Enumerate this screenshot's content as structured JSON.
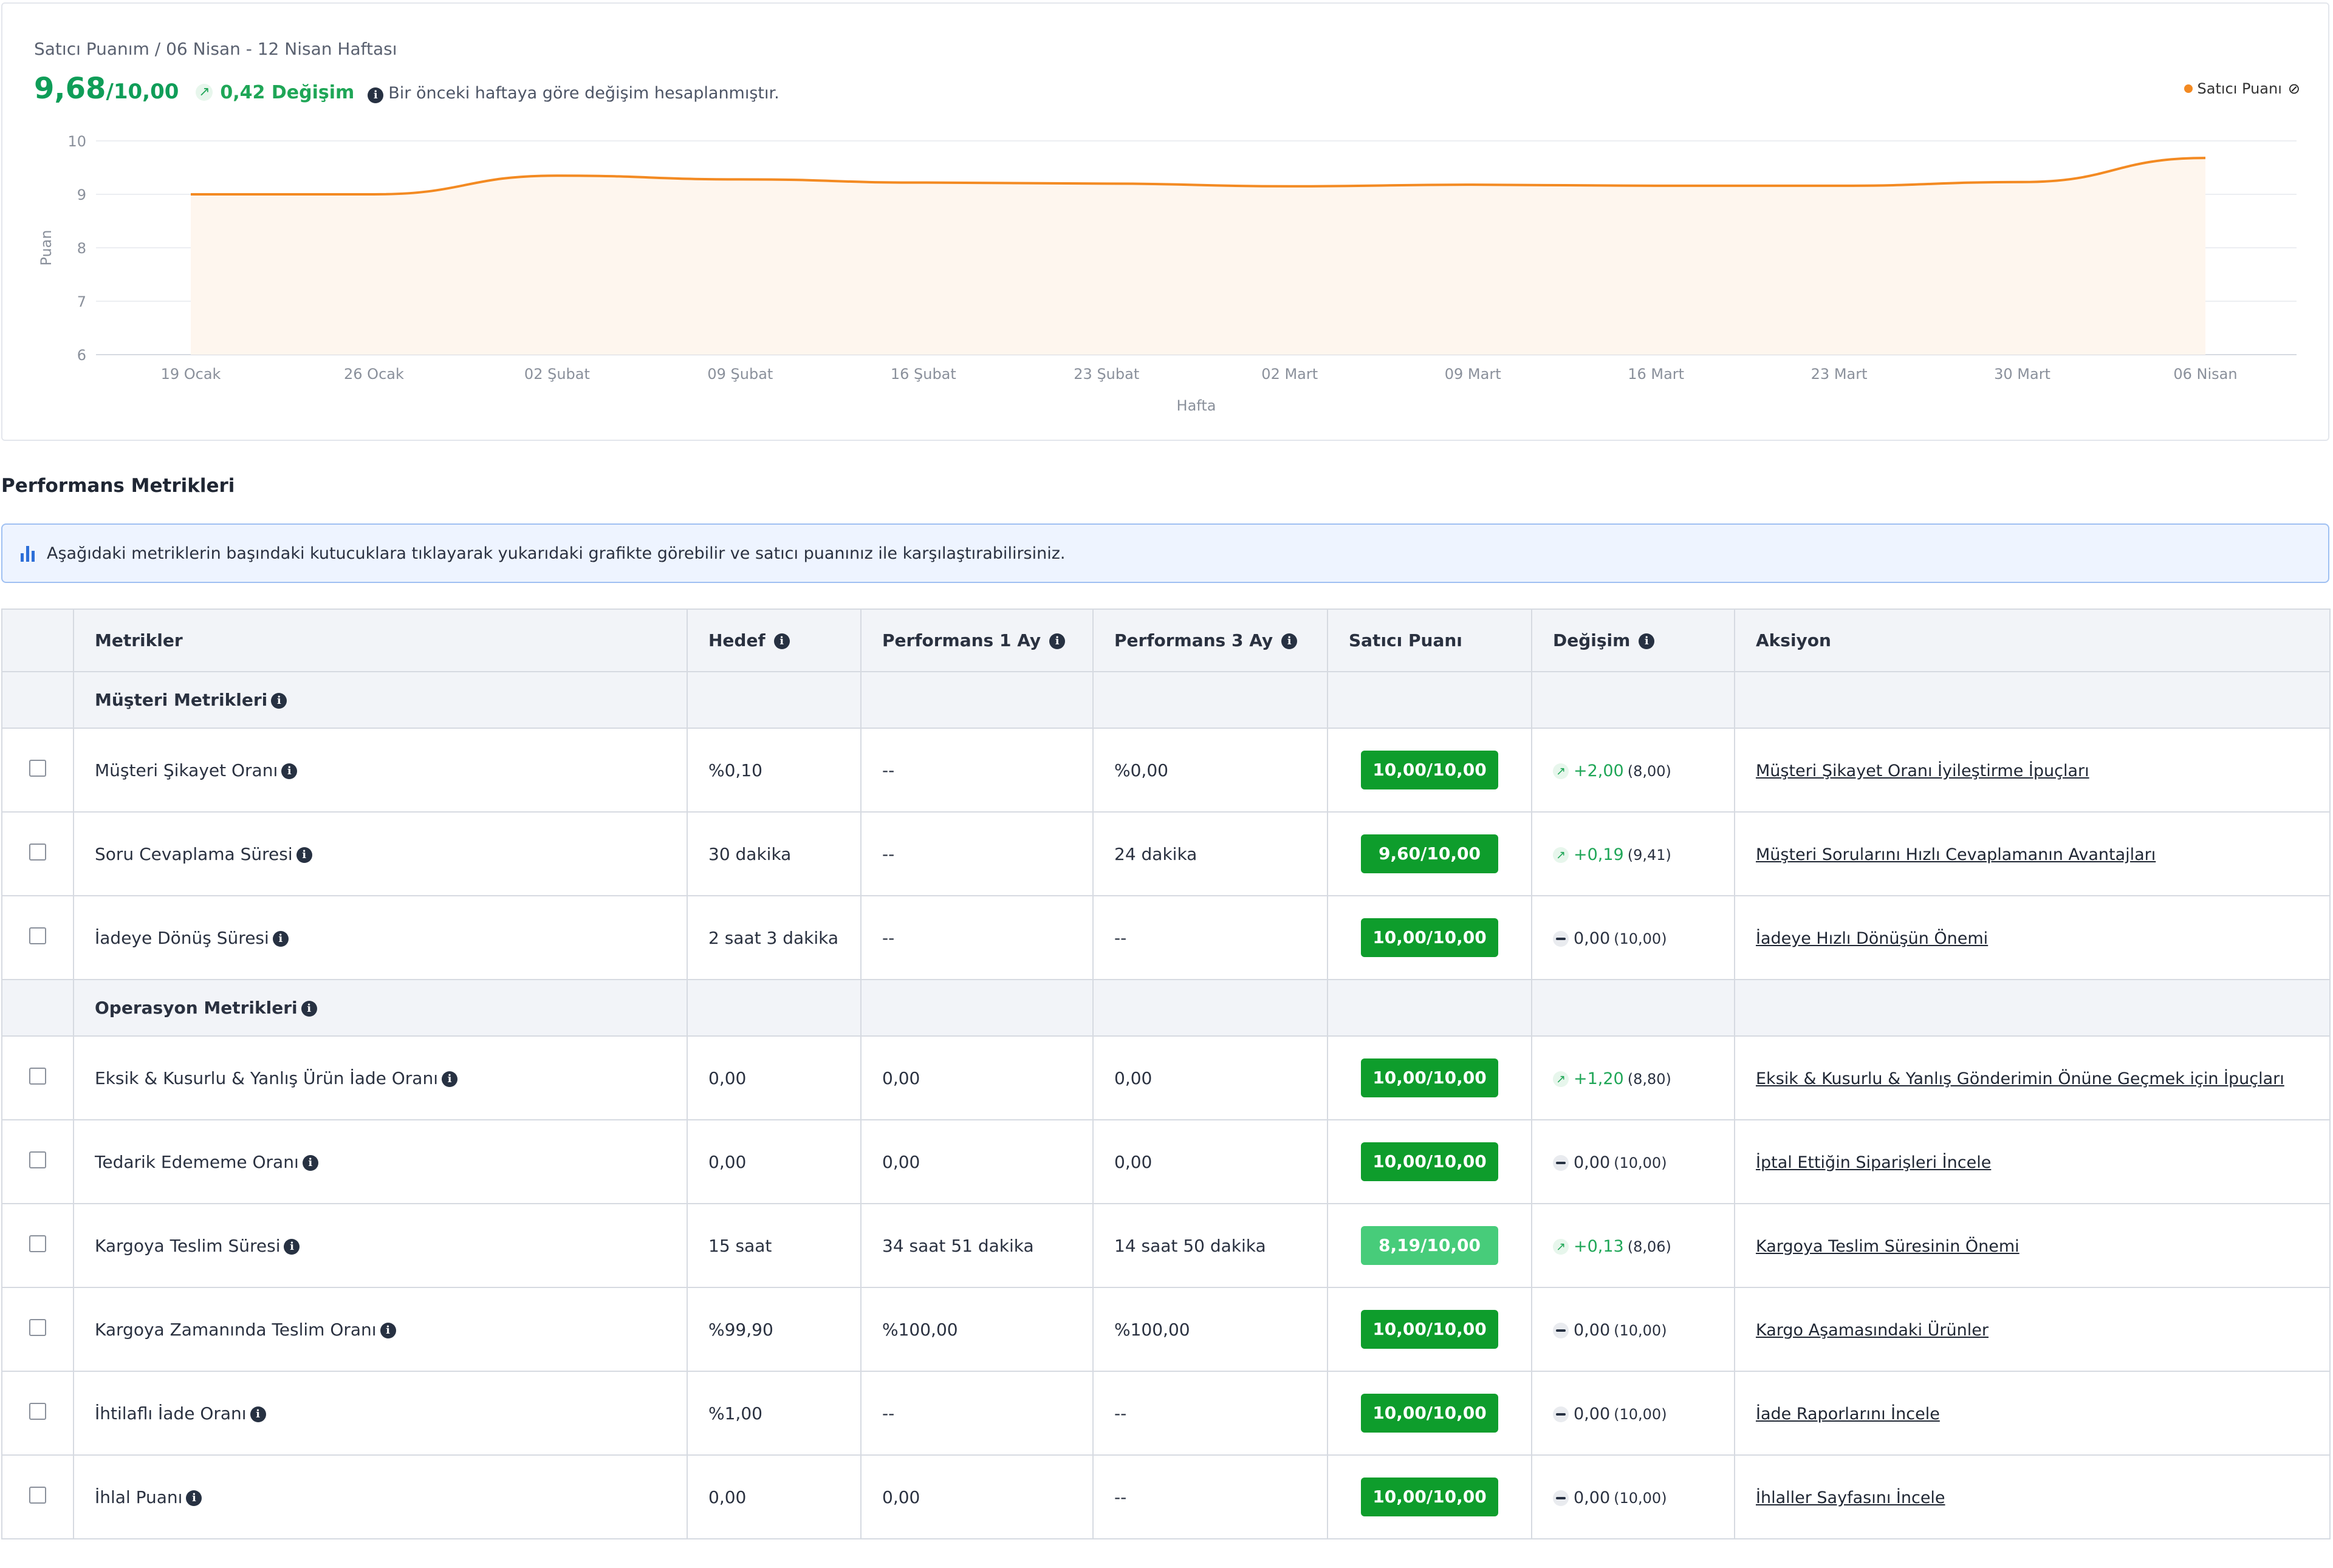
{
  "header": {
    "breadcrumb": "Satıcı Puanım / 06 Nisan - 12 Nisan Haftası",
    "score": "9,68",
    "score_max": "/10,00",
    "change_text": "0,42 Değişim",
    "change_note": "Bir önceki haftaya göre değişim hesaplanmıştır.",
    "legend_label": "Satıcı Puanı"
  },
  "chart_data": {
    "type": "area",
    "xlabel": "Hafta",
    "ylabel": "Puan",
    "ylim": [
      6,
      10
    ],
    "yticks": [
      6,
      7,
      8,
      9,
      10
    ],
    "x": [
      "19 Ocak",
      "26 Ocak",
      "02 Şubat",
      "09 Şubat",
      "16 Şubat",
      "23 Şubat",
      "02 Mart",
      "09 Mart",
      "16 Mart",
      "23 Mart",
      "30 Mart",
      "06 Nisan"
    ],
    "series": [
      {
        "name": "Satıcı Puanı",
        "values": [
          9.0,
          9.0,
          9.35,
          9.28,
          9.22,
          9.2,
          9.15,
          9.18,
          9.16,
          9.16,
          9.23,
          9.68
        ]
      }
    ],
    "colors": {
      "line": "#f38a22",
      "fill": "#fef6ee",
      "grid": "#eceef2"
    },
    "grid": true,
    "legend": "top-right"
  },
  "section_title": "Performans Metrikleri",
  "banner_text": "Aşağıdaki metriklerin başındaki kutucuklara tıklayarak yukarıdaki grafikte görebilir ve satıcı puanınız ile karşılaştırabilirsiniz.",
  "table": {
    "headers": {
      "metric": "Metrikler",
      "target": "Hedef",
      "perf1": "Performans 1 Ay",
      "perf3": "Performans 3 Ay",
      "score": "Satıcı Puanı",
      "change": "Değişim",
      "action": "Aksiyon"
    },
    "groups": [
      {
        "title": "Müşteri Metrikleri",
        "rows": [
          {
            "metric": "Müşteri Şikayet Oranı",
            "target": "%0,10",
            "perf1": "--",
            "perf3": "%0,00",
            "score": "10,00/10,00",
            "score_level": "full",
            "change_dir": "up",
            "change": "+2,00",
            "prev": "(8,00)",
            "action": "Müşteri Şikayet Oranı İyileştirme İpuçları"
          },
          {
            "metric": "Soru Cevaplama Süresi",
            "target": "30 dakika",
            "perf1": "--",
            "perf3": "24 dakika",
            "score": "9,60/10,00",
            "score_level": "full",
            "change_dir": "up",
            "change": "+0,19",
            "prev": "(9,41)",
            "action": "Müşteri Sorularını Hızlı Cevaplamanın Avantajları"
          },
          {
            "metric": "İadeye Dönüş Süresi",
            "target": "2 saat 3 dakika",
            "perf1": "--",
            "perf3": "--",
            "score": "10,00/10,00",
            "score_level": "full",
            "change_dir": "flat",
            "change": "0,00",
            "prev": "(10,00)",
            "action": "İadeye Hızlı Dönüşün Önemi"
          }
        ]
      },
      {
        "title": "Operasyon Metrikleri",
        "rows": [
          {
            "metric": "Eksik & Kusurlu & Yanlış Ürün İade Oranı",
            "target": "0,00",
            "perf1": "0,00",
            "perf3": "0,00",
            "score": "10,00/10,00",
            "score_level": "full",
            "change_dir": "up",
            "change": "+1,20",
            "prev": "(8,80)",
            "action": "Eksik & Kusurlu & Yanlış Gönderimin Önüne Geçmek için İpuçları"
          },
          {
            "metric": "Tedarik Edememe Oranı",
            "target": "0,00",
            "perf1": "0,00",
            "perf3": "0,00",
            "score": "10,00/10,00",
            "score_level": "full",
            "change_dir": "flat",
            "change": "0,00",
            "prev": "(10,00)",
            "action": "İptal Ettiğin Siparişleri İncele"
          },
          {
            "metric": "Kargoya Teslim Süresi",
            "target": "15 saat",
            "perf1": "34 saat 51 dakika",
            "perf3": "14 saat 50 dakika",
            "score": "8,19/10,00",
            "score_level": "mid",
            "change_dir": "up",
            "change": "+0,13",
            "prev": "(8,06)",
            "action": "Kargoya Teslim Süresinin Önemi"
          },
          {
            "metric": "Kargoya Zamanında Teslim Oranı",
            "target": "%99,90",
            "perf1": "%100,00",
            "perf3": "%100,00",
            "score": "10,00/10,00",
            "score_level": "full",
            "change_dir": "flat",
            "change": "0,00",
            "prev": "(10,00)",
            "action": "Kargo Aşamasındaki Ürünler"
          },
          {
            "metric": "İhtilaflı İade Oranı",
            "target": "%1,00",
            "perf1": "--",
            "perf3": "--",
            "score": "10,00/10,00",
            "score_level": "full",
            "change_dir": "flat",
            "change": "0,00",
            "prev": "(10,00)",
            "action": "İade Raporlarını İncele"
          },
          {
            "metric": "İhlal Puanı",
            "target": "0,00",
            "perf1": "0,00",
            "perf3": "--",
            "score": "10,00/10,00",
            "score_level": "full",
            "change_dir": "flat",
            "change": "0,00",
            "prev": "(10,00)",
            "action": "İhlaller Sayfasını İncele"
          }
        ]
      }
    ]
  },
  "colors": {
    "score_full": "#0e9d2c",
    "score_mid": "#47cc7a",
    "positive": "#1fa657"
  }
}
